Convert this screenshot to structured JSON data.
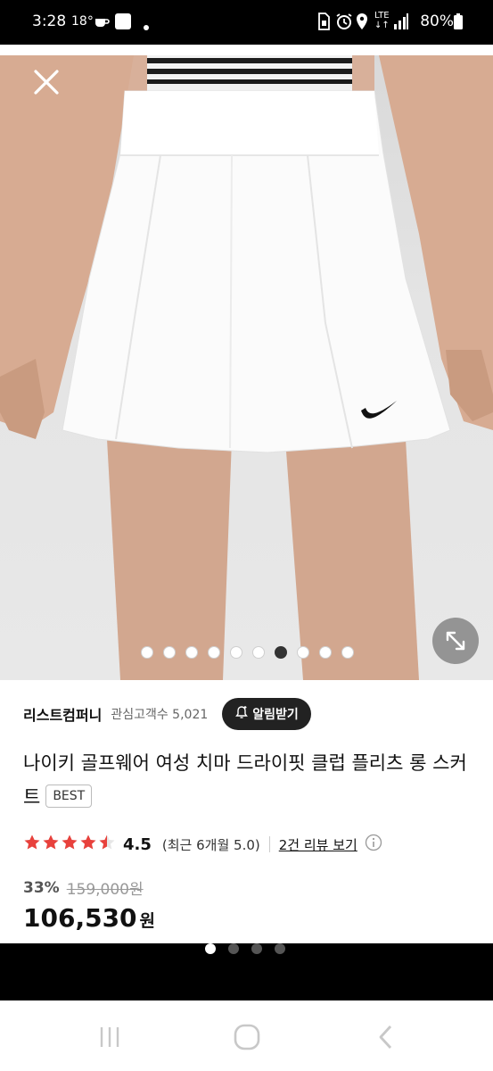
{
  "status_bar": {
    "time": "3:28",
    "temperature": "18°",
    "battery": "80%",
    "icons": [
      "coffee-icon",
      "app-icon",
      "dot-icon",
      "sim-icon",
      "alarm-icon",
      "location-icon",
      "lte-icon",
      "signal-icon",
      "battery-icon"
    ]
  },
  "hero": {
    "close_icon": "close-icon",
    "expand_icon": "expand-icon",
    "image_count": 10,
    "active_index": 6
  },
  "store": {
    "name": "리스트컴퍼니",
    "followers": "관심고객수 5,021",
    "alarm_label": "알림받기"
  },
  "product": {
    "title": "나이키 골프웨어 여성 치마 드라이핏 클럽 플리츠 롱 스커트",
    "badge": "BEST",
    "rating": "4.5",
    "rating_stars": 4.5,
    "recent": "(최근 6개월 5.0)",
    "reviews": "2건 리뷰 보기",
    "discount": "33%",
    "original_price": "159,000원",
    "price": "106,530",
    "currency": "원"
  },
  "pager": {
    "count": 4,
    "active_index": 0
  },
  "colors": {
    "star": "#e8413c",
    "alarm_bg": "#222222",
    "active_dot": "#333333"
  }
}
